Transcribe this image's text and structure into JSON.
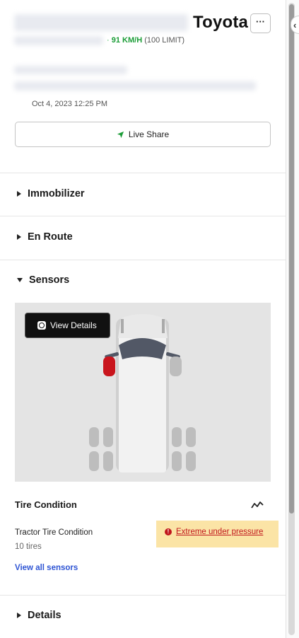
{
  "header": {
    "make": "Toyota",
    "more_label": "···",
    "speed_value": "91 KM/H",
    "speed_limit": "(100 LIMIT)",
    "timestamp": "Oct 4, 2023 12:25 PM"
  },
  "live_share_label": "Live Share",
  "sections": {
    "immobilizer": "Immobilizer",
    "en_route": "En Route",
    "sensors": "Sensors",
    "details": "Details"
  },
  "sensors": {
    "view_details_label": "View Details",
    "tire_condition_title": "Tire Condition",
    "tractor_label": "Tractor Tire Condition",
    "tire_count": "10 tires",
    "alert_text": "Extreme under pressure",
    "view_all_label": "View all sensors",
    "flagged_tire": "front-left"
  },
  "colors": {
    "speed_green": "#1a9c36",
    "alert_bg": "#fbe4a6",
    "alert_red": "#c0151b",
    "link_blue": "#2f55d4"
  }
}
